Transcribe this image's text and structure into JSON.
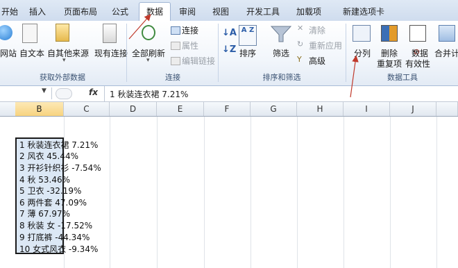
{
  "tabs": [
    "开始",
    "插入",
    "页面布局",
    "公式",
    "数据",
    "审阅",
    "视图",
    "开发工具",
    "加载项",
    "新建选项卡"
  ],
  "active_tab": "数据",
  "groups": {
    "external_data": {
      "label": "获取外部数据",
      "web": "网站",
      "text": "自文本",
      "other": "自其他来源",
      "existing": "现有连接"
    },
    "connections": {
      "label": "连接",
      "refresh_all": "全部刷新",
      "connections": "连接",
      "properties": "属性",
      "edit_links": "编辑链接"
    },
    "sort_filter": {
      "label": "排序和筛选",
      "sort": "排序",
      "filter": "筛选",
      "clear": "清除",
      "reapply": "重新应用",
      "advanced": "高级"
    },
    "data_tools": {
      "label": "数据工具",
      "text_to_columns": "分列",
      "remove_duplicates_1": "删除",
      "remove_duplicates_2": "重复项",
      "validation_1": "数据",
      "validation_2": "有效性",
      "consolidate": "合并计"
    }
  },
  "formula_bar": {
    "fx": "fx",
    "content": "1  秋装连衣裙  7.21%"
  },
  "columns": [
    "B",
    "C",
    "D",
    "E",
    "F",
    "G",
    "H",
    "I",
    "J"
  ],
  "selected_column": "B",
  "cells": [
    "1  秋装连衣裙  7.21%",
    "2  风衣  45.44%",
    "3  开衫针织衫  -7.54%",
    "4  秋  53.46%",
    "5  卫衣  -32.19%",
    "6  两件套  47.09%",
    "7  薄  67.97%",
    "8  秋装  女  -17.52%",
    "9  打底裤  -44.34%",
    "10  女式风衣  -9.34%"
  ],
  "colors": {
    "ribbon_bg": "#eef3fa",
    "selected_header": "#f7d37f",
    "selection_fill": "#dce8f5",
    "annotation_arrow": "#c0392b"
  }
}
